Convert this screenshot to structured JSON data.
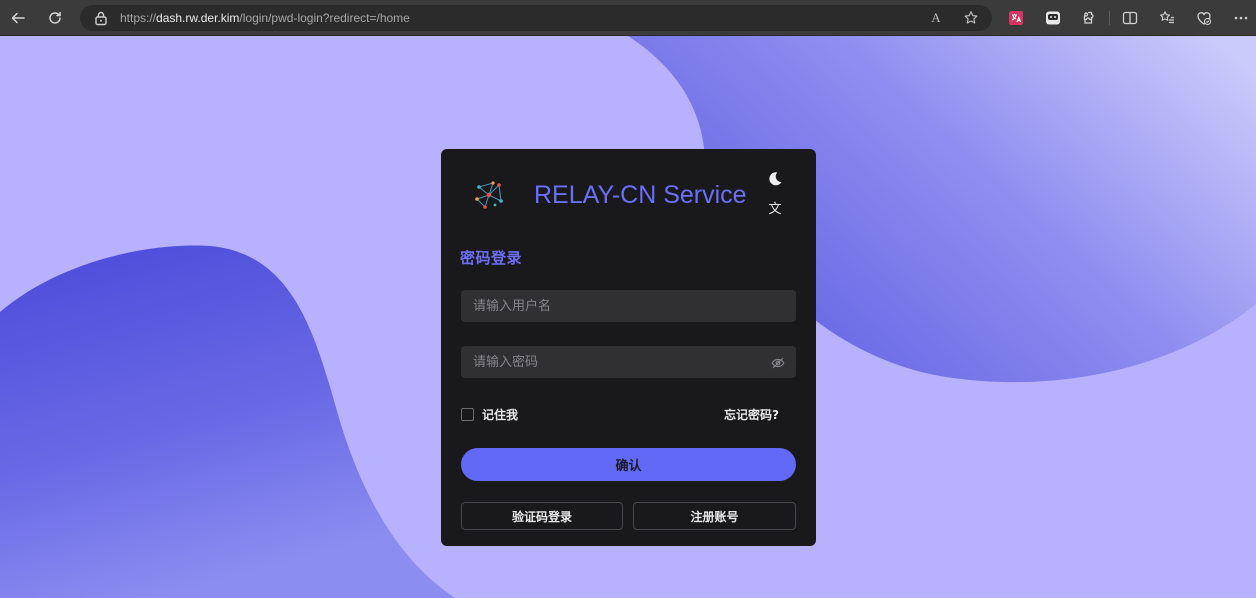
{
  "browser": {
    "url_prefix": "https://",
    "url_host": "dash.rw.der.kim",
    "url_path": "/login/pwd-login?redirect=/home",
    "read_aloud_label": "A",
    "colors": {
      "toolbar": "#3b3b3b",
      "address_bar": "#2b2b2b"
    }
  },
  "login": {
    "brand_title": "RELAY-CN Service",
    "form_title": "密码登录",
    "username_placeholder": "请输入用户名",
    "password_placeholder": "请输入密码",
    "remember_label": "记住我",
    "forgot_label": "忘记密码?",
    "confirm_label": "确认",
    "code_login_label": "验证码登录",
    "register_label": "注册账号",
    "lang_icon_glyph": "文",
    "remember_checked": false
  },
  "colors": {
    "page_background": "#b8b1fd",
    "card_background": "#19191c",
    "accent": "#6369f7",
    "input_background": "#303033"
  }
}
